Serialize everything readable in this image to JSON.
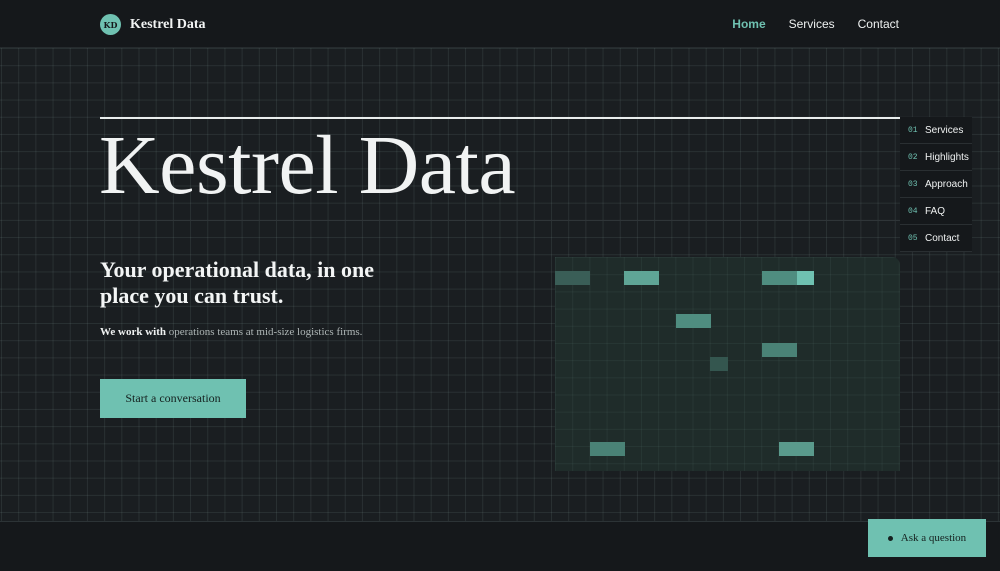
{
  "brand": {
    "logo_text": "KD",
    "name": "Kestrel Data"
  },
  "topnav": {
    "home": "Home",
    "services": "Services",
    "contact": "Contact"
  },
  "hero": {
    "title": "Kestrel Data",
    "tagline": "Your operational data, in one place you can trust.",
    "intro_bold": "We work with",
    "intro_rest": "operations teams at mid-size logistics firms.",
    "cta_label": "Start a conversation"
  },
  "section_nav": [
    {
      "num": "01",
      "label": "Services"
    },
    {
      "num": "02",
      "label": "Highlights"
    },
    {
      "num": "03",
      "label": "Approach"
    },
    {
      "num": "04",
      "label": "FAQ"
    },
    {
      "num": "05",
      "label": "Contact"
    }
  ],
  "chat": {
    "label": "Ask a question"
  },
  "colors": {
    "accent": "#6fc1b1",
    "background": "#15181b",
    "panel": "#1f2c2a"
  }
}
